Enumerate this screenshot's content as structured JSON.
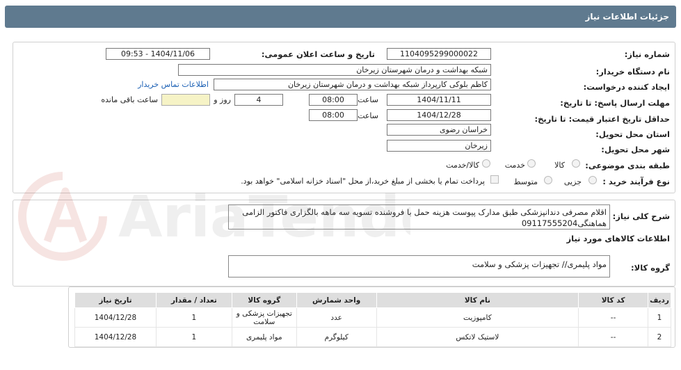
{
  "header": {
    "title": "جزئیات اطلاعات نیاز"
  },
  "form": {
    "need_number_label": "شماره نیاز:",
    "need_number": "1104095299000022",
    "announce_label": "تاریخ و ساعت اعلان عمومی:",
    "announce_value": "1404/11/06 - 09:53",
    "buyer_org_label": "نام دستگاه خریدار:",
    "buyer_org": "شبکه بهداشت و درمان شهرستان زیرخان",
    "requester_label": "ایجاد کننده درخواست:",
    "requester": "کاظم بلوکی کارپرداز شبکه بهداشت و درمان شهرستان زیرخان",
    "contact_link": "اطلاعات تماس خریدار",
    "reply_deadline_label": "مهلت ارسال پاسخ: تا تاریخ:",
    "reply_date": "1404/11/11",
    "time_label": "ساعت",
    "reply_time": "08:00",
    "days_value": "4",
    "days_label": "روز و",
    "remaining_value": "",
    "remaining_label": "ساعت باقی مانده",
    "validity_label": "حداقل تاریخ اعتبار قیمت: تا تاریخ:",
    "validity_date": "1404/12/28",
    "validity_time": "08:00",
    "province_label": "استان محل تحویل:",
    "province": "خراسان رضوی",
    "city_label": "شهر محل تحویل:",
    "city": "زیرخان",
    "category_label": "طبقه بندی موضوعی:",
    "category_options": [
      "کالا",
      "خدمت",
      "کالا/خدمت"
    ],
    "process_label": "نوع فرآیند خرید :",
    "process_options": [
      "جزیی",
      "متوسط"
    ],
    "payment_note": "پرداخت تمام یا بخشی از مبلغ خرید،از محل \"اسناد خزانه اسلامی\" خواهد بود."
  },
  "description": {
    "label": "شرح کلی نیاز:",
    "text": "اقلام مصرفی دندانپزشکی طبق مدارک پیوست هزینه حمل با فروشنده تسویه سه ماهه بالگزاری فاکتور الزامی هماهنگی09117555204"
  },
  "goods_section": {
    "title": "اطلاعات کالاهای مورد نیاز",
    "group_label": "گروه کالا:",
    "group_value": "مواد پلیمری// تجهیزات پزشکی و سلامت"
  },
  "table": {
    "headers": [
      "ردیف",
      "کد کالا",
      "نام کالا",
      "واحد شمارش",
      "گروه کالا",
      "تعداد / مقدار",
      "تاریخ نیاز"
    ],
    "rows": [
      [
        "1",
        "--",
        "کامپوزیت",
        "عدد",
        "تجهیزات پزشکی و سلامت",
        "1",
        "1404/12/28"
      ],
      [
        "2",
        "--",
        "لاستیک لاتکس",
        "کیلوگرم",
        "مواد پلیمری",
        "1",
        "1404/12/28"
      ]
    ]
  },
  "watermark": {
    "text": "AriaTender.neT"
  }
}
